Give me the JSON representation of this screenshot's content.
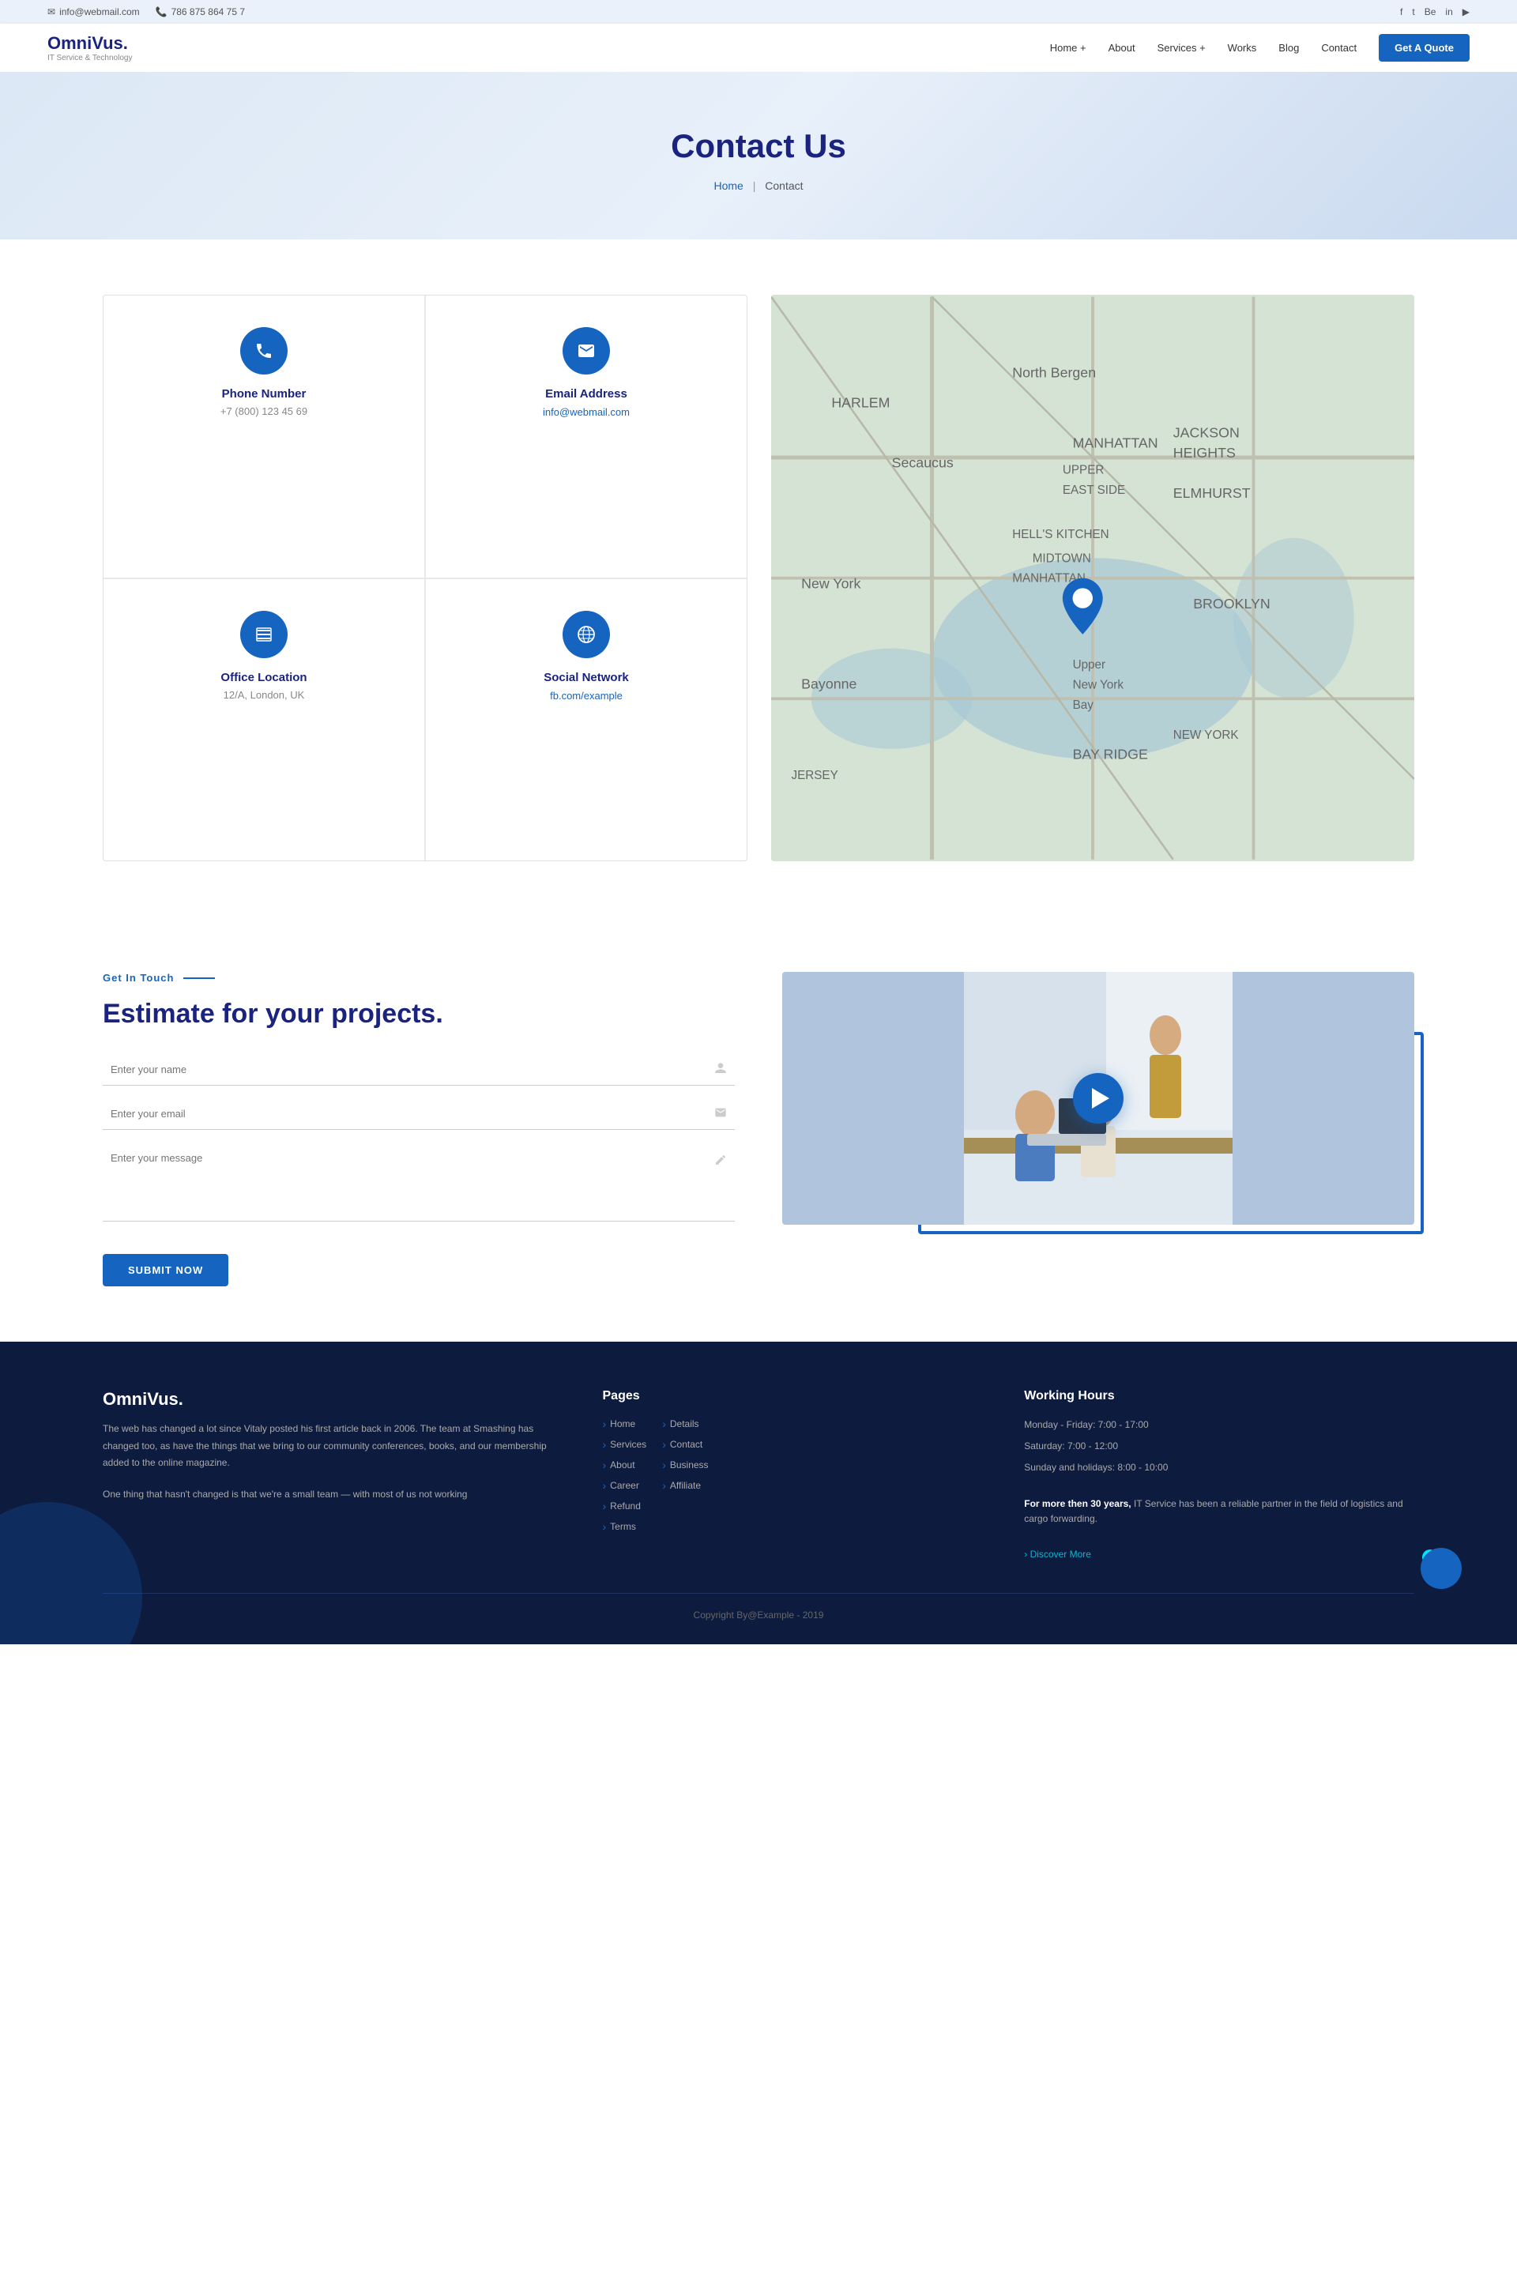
{
  "topbar": {
    "email": "info@webmail.com",
    "phone": "786 875 864 75 7",
    "email_icon": "✉",
    "phone_icon": "📞"
  },
  "social": {
    "links": [
      "f",
      "t",
      "Be",
      "in",
      "▶"
    ]
  },
  "navbar": {
    "logo_name": "OmniVus.",
    "logo_sub": "IT Service & Technology",
    "links": [
      {
        "label": "Home +",
        "href": "#"
      },
      {
        "label": "About",
        "href": "#"
      },
      {
        "label": "Services +",
        "href": "#"
      },
      {
        "label": "Works",
        "href": "#"
      },
      {
        "label": "Blog",
        "href": "#"
      },
      {
        "label": "Contact",
        "href": "#"
      }
    ],
    "cta_label": "Get A Quote"
  },
  "hero": {
    "title": "Contact Us",
    "breadcrumb_home": "Home",
    "breadcrumb_sep": "|",
    "breadcrumb_current": "Contact"
  },
  "contact_cards": [
    {
      "icon": "☏",
      "title": "Phone Number",
      "value": "+7 (800) 123 45 69"
    },
    {
      "icon": "✉",
      "title": "Email Address",
      "value": "info@webmail.com",
      "is_link": true
    },
    {
      "icon": "⊞",
      "title": "Office Location",
      "value": "12/A, London, UK"
    },
    {
      "icon": "⊕",
      "title": "Social Network",
      "value": "fb.com/example",
      "is_link": true
    }
  ],
  "estimate": {
    "section_label": "Get In Touch",
    "title": "Estimate for your projects.",
    "name_placeholder": "Enter your name",
    "email_placeholder": "Enter your email",
    "message_placeholder": "Enter your message",
    "submit_label": "Submit Now"
  },
  "footer": {
    "brand_name": "OmniVus.",
    "brand_text1": "The web has changed a lot since Vitaly posted his first article back in 2006. The team at Smashing has changed too, as have the things that we bring to our community conferences, books, and our membership added to the online magazine.",
    "brand_text2": "One thing that hasn't changed is that we're a small team — with most of us not working",
    "pages_title": "Pages",
    "pages_col1": [
      "Home",
      "Services",
      "About",
      "Career",
      "Refund",
      "Terms"
    ],
    "pages_col2": [
      "Details",
      "Contact",
      "Business",
      "Affiliate"
    ],
    "hours_title": "Working Hours",
    "hours_lines": [
      "Monday - Friday: 7:00 - 17:00",
      "Saturday: 7:00 - 12:00",
      "Sunday and holidays: 8:00 - 10:00"
    ],
    "hours_note_bold": "For more then 30 years,",
    "hours_note_text": " IT Service has been a reliable partner in the field of logistics and cargo forwarding.",
    "discover_link": "› Discover More",
    "copyright": "Copyright By@Example - 2019"
  }
}
